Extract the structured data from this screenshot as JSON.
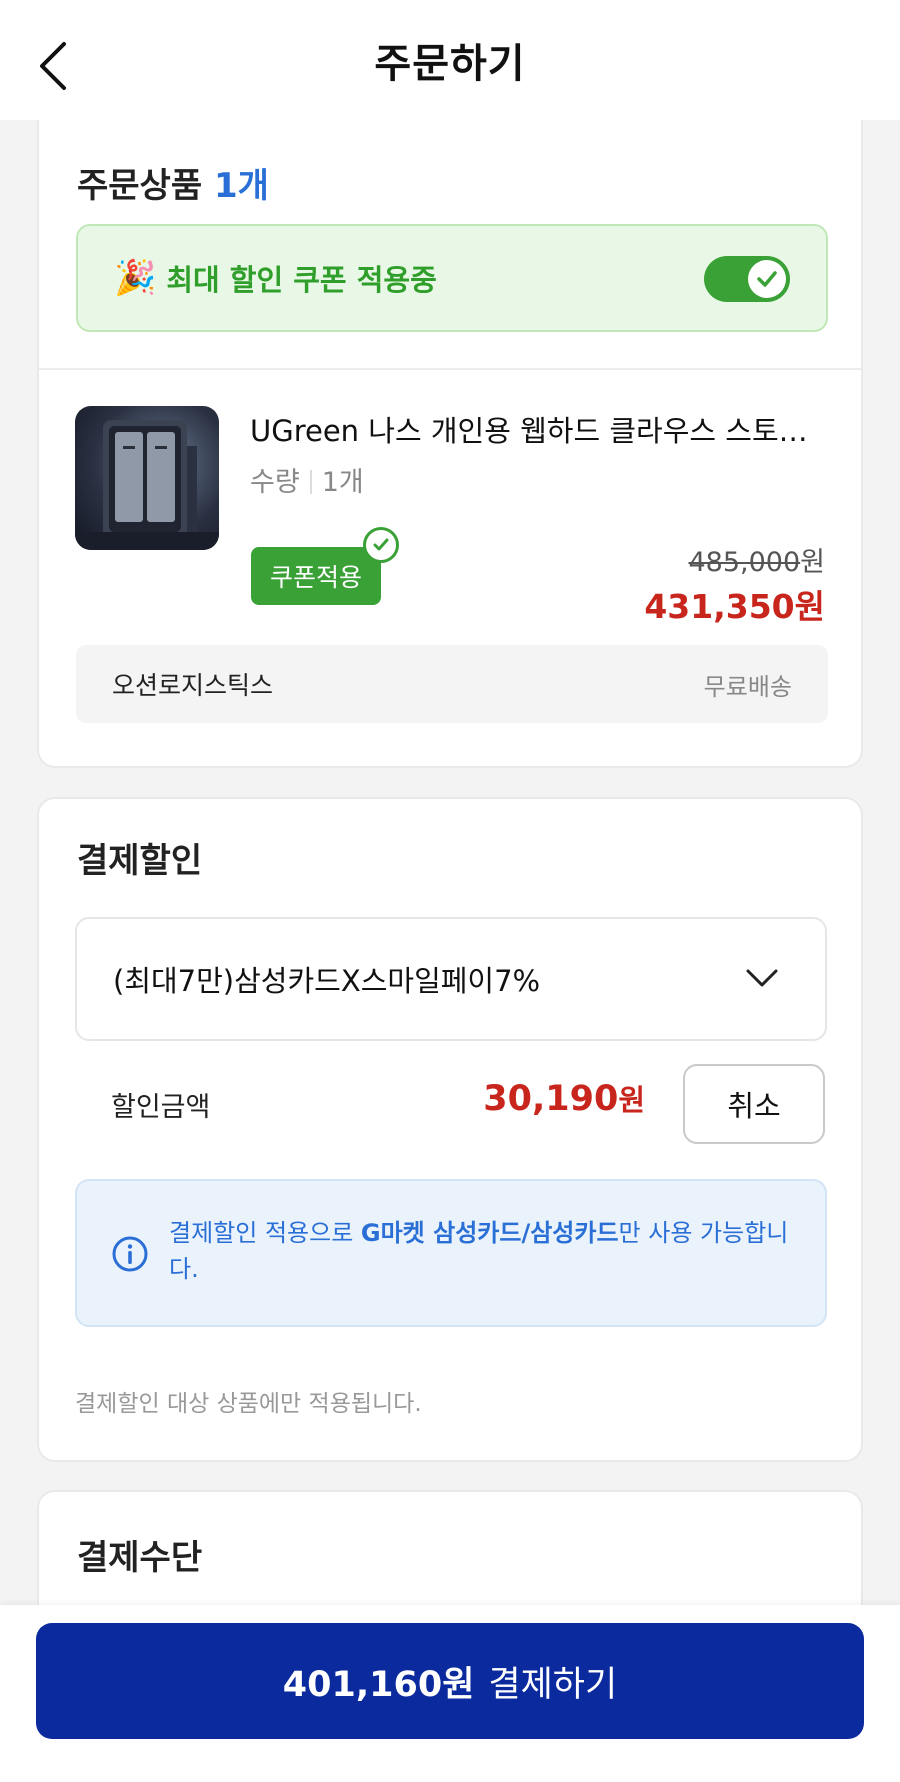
{
  "header": {
    "title": "주문하기"
  },
  "order_items": {
    "title": "주문상품",
    "count": "1개",
    "coupon_banner": {
      "icon": "party-popper-icon",
      "text": "최대 할인 쿠폰 적용중",
      "toggle_on": true
    },
    "product": {
      "name": "UGreen 나스 개인용 웹하드 클라우스 스토리…",
      "qty_label": "수량",
      "qty_value": "1개",
      "coupon_badge": "쿠폰적용",
      "original_price": "485,000",
      "original_unit": "원",
      "sale_price": "431,350원"
    },
    "seller": {
      "name": "오션로지스틱스",
      "shipping": "무료배송"
    }
  },
  "payment_discount": {
    "title": "결제할인",
    "selected_option": "(최대7만)삼성카드X스마일페이7%",
    "amount_label": "할인금액",
    "amount_value": "30,190",
    "amount_unit": "원",
    "cancel_label": "취소",
    "info": {
      "prefix": "결제할인 적용으로 ",
      "highlight": "G마켓 삼성카드/삼성카드",
      "suffix": "만 사용 가능합니다."
    },
    "note": "결제할인 대상 상품에만 적용됩니다."
  },
  "payment_method": {
    "title": "결제수단"
  },
  "checkout": {
    "amount": "401,160원",
    "label": "결제하기"
  },
  "colors": {
    "accent_blue": "#2a6fd6",
    "coupon_green": "#3aa136",
    "price_red": "#c8261d",
    "pay_button": "#0b2a9e"
  }
}
